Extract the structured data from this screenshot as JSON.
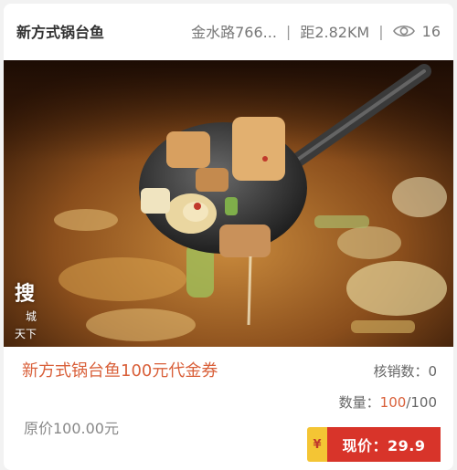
{
  "header": {
    "shop_name": "新方式锅台鱼",
    "address": "金水路766...",
    "distance": "距2.82KM",
    "views": "16",
    "view_icon": "eye-icon"
  },
  "image": {
    "watermark_main": "搜",
    "watermark_sub1": "城",
    "watermark_sub2": "天下"
  },
  "offer": {
    "title": "新方式锅台鱼100元代金券",
    "redeemed_label": "核销数：",
    "redeemed_value": "0",
    "quantity_label": "数量：",
    "quantity_left": "100",
    "quantity_total": "/100",
    "original_price": "原价100.00元",
    "yen_symbol": "¥",
    "current_price": "现价：29.9"
  },
  "colors": {
    "accent": "#d9603a",
    "price_red": "#d8342a",
    "tag_yellow": "#f4c534"
  }
}
